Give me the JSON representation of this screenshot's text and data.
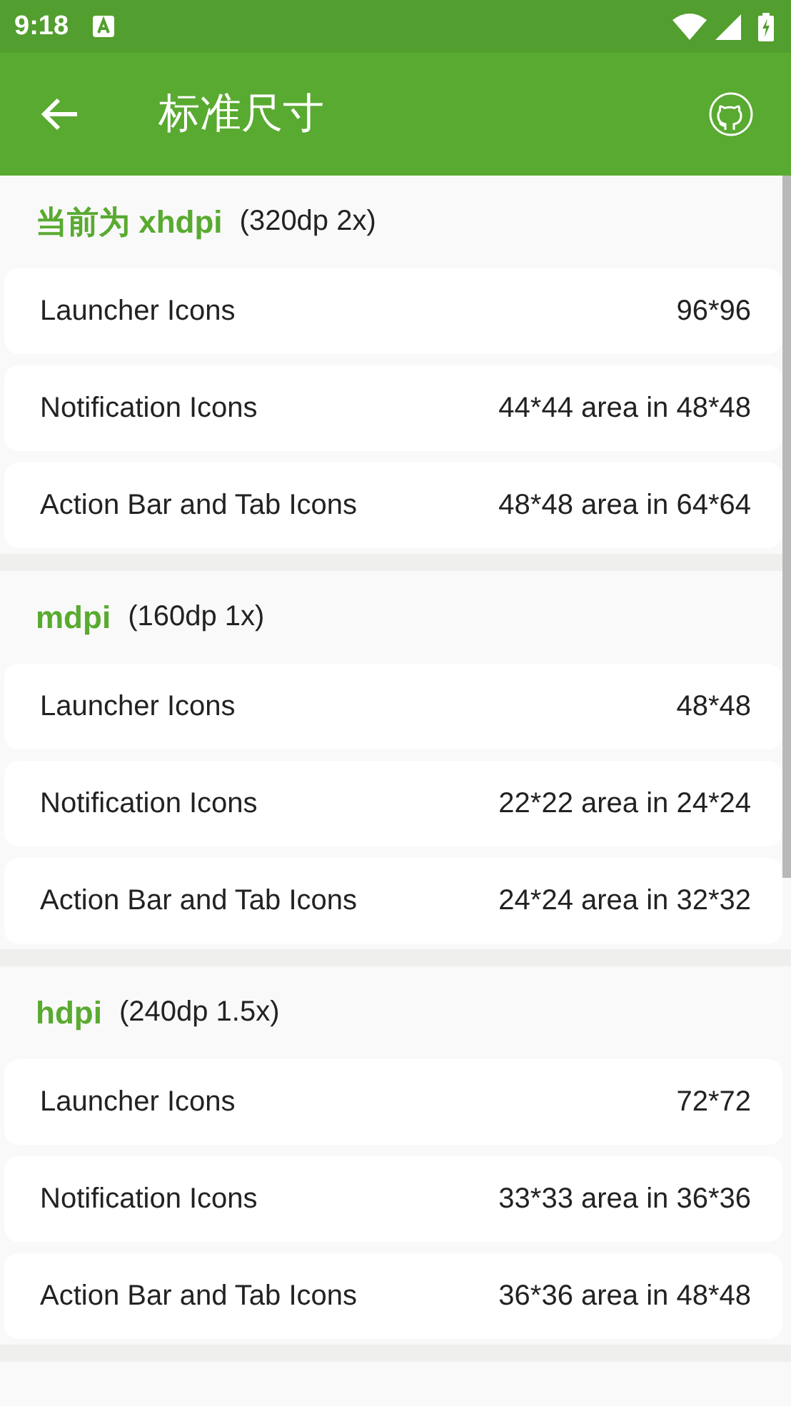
{
  "status_bar": {
    "time": "9:18"
  },
  "toolbar": {
    "title": "标准尺寸"
  },
  "sections": [
    {
      "name": "当前为 xhdpi",
      "detail": "(320dp 2x)",
      "rows": [
        {
          "label": "Launcher Icons",
          "value": "96*96"
        },
        {
          "label": "Notification Icons",
          "value": "44*44 area in 48*48"
        },
        {
          "label": "Action Bar and Tab Icons",
          "value": "48*48 area in 64*64"
        }
      ]
    },
    {
      "name": "mdpi",
      "detail": "(160dp 1x)",
      "rows": [
        {
          "label": "Launcher Icons",
          "value": "48*48"
        },
        {
          "label": "Notification Icons",
          "value": "22*22 area in 24*24"
        },
        {
          "label": "Action Bar and Tab Icons",
          "value": "24*24 area in 32*32"
        }
      ]
    },
    {
      "name": "hdpi",
      "detail": "(240dp 1.5x)",
      "rows": [
        {
          "label": "Launcher Icons",
          "value": "72*72"
        },
        {
          "label": "Notification Icons",
          "value": "33*33 area in 36*36"
        },
        {
          "label": "Action Bar and Tab Icons",
          "value": "36*36 area in 48*48"
        }
      ]
    }
  ]
}
